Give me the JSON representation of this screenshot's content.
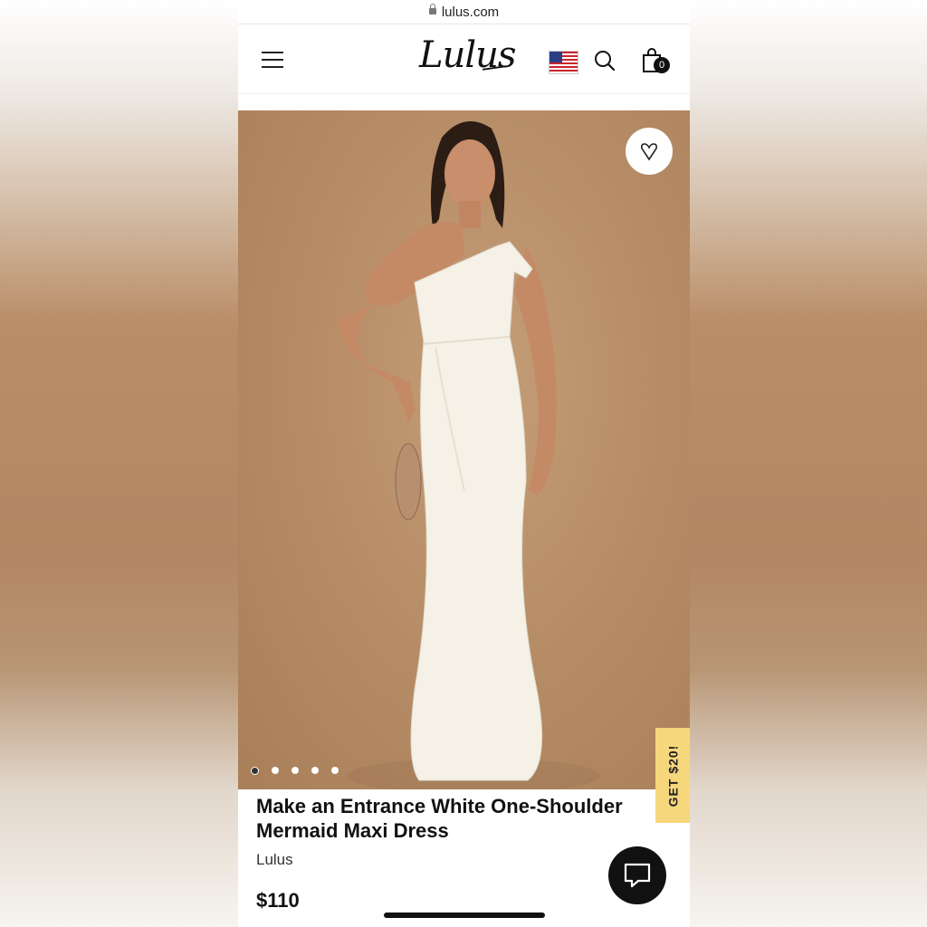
{
  "browser": {
    "url": "lulus.com"
  },
  "header": {
    "brand_logo": "Lulus",
    "cart_count": "0",
    "icons": [
      "menu-icon",
      "us-flag-icon",
      "search-icon",
      "shopping-bag-icon"
    ]
  },
  "product": {
    "image_dots": 5,
    "active_dot": 1,
    "title": "Make an Entrance White One-Shoulder Mermaid Maxi Dress",
    "brand": "Lulus",
    "price": "$110"
  },
  "promo": {
    "label": "GET $20!"
  },
  "colors": {
    "promo_tab": "#f7d77c",
    "chat_button": "#111111",
    "backdrop": "#b88f69"
  }
}
